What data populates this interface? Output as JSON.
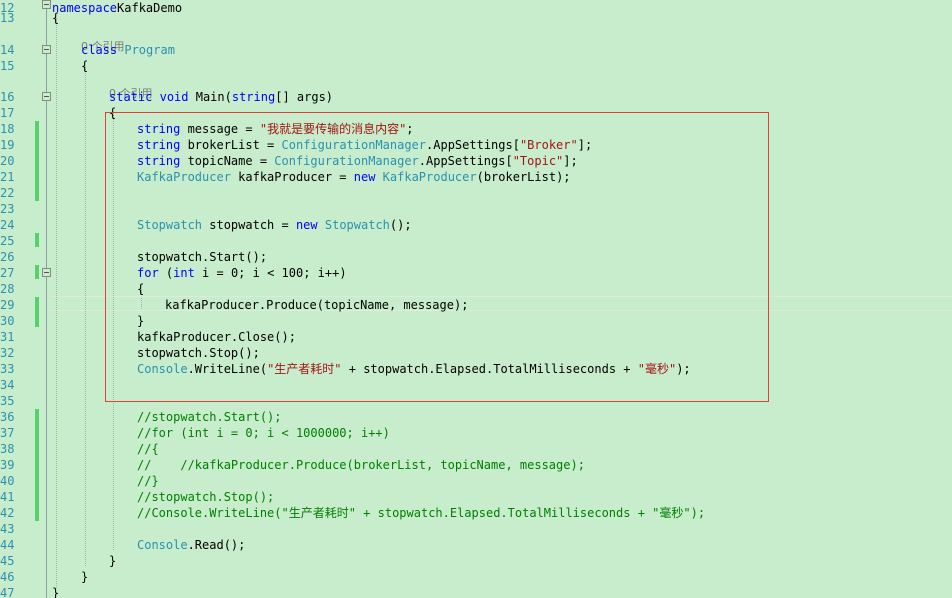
{
  "editor": {
    "ref_hint": "0 个引用",
    "lines": [
      {
        "n": "12",
        "t": 0,
        "i": 52,
        "p": [
          [
            "kw",
            "namespace"
          ],
          [
            "",
            "KafkaDemo"
          ]
        ]
      },
      {
        "n": "13",
        "t": 10,
        "i": 52,
        "p": [
          [
            "",
            "{"
          ]
        ]
      },
      {
        "n": "14",
        "t": 42,
        "i": 81,
        "p": [
          [
            "kw",
            "class"
          ],
          [
            "",
            " "
          ],
          [
            "ty",
            "Program"
          ]
        ]
      },
      {
        "n": "15",
        "t": 58,
        "i": 81,
        "p": [
          [
            "",
            "{"
          ]
        ]
      },
      {
        "n": "16",
        "t": 89,
        "i": 109,
        "p": [
          [
            "kw",
            "static"
          ],
          [
            "",
            " "
          ],
          [
            "kw",
            "void"
          ],
          [
            "",
            " Main("
          ],
          [
            "kw",
            "string"
          ],
          [
            "",
            "[] args)"
          ]
        ]
      },
      {
        "n": "17",
        "t": 105,
        "i": 109,
        "p": [
          [
            "",
            "{"
          ]
        ]
      },
      {
        "n": "18",
        "t": 121,
        "i": 137,
        "p": [
          [
            "kw",
            "string"
          ],
          [
            "",
            " message = "
          ],
          [
            "str",
            "\"我就是要传输的消息内容\""
          ],
          [
            "",
            ";"
          ]
        ]
      },
      {
        "n": "19",
        "t": 137,
        "i": 137,
        "p": [
          [
            "kw",
            "string"
          ],
          [
            "",
            " brokerList = "
          ],
          [
            "ty",
            "ConfigurationManager"
          ],
          [
            "",
            ".AppSettings["
          ],
          [
            "str",
            "\"Broker\""
          ],
          [
            "",
            "];"
          ]
        ]
      },
      {
        "n": "20",
        "t": 153,
        "i": 137,
        "p": [
          [
            "kw",
            "string"
          ],
          [
            "",
            " topicName = "
          ],
          [
            "ty",
            "ConfigurationManager"
          ],
          [
            "",
            ".AppSettings["
          ],
          [
            "str",
            "\"Topic\""
          ],
          [
            "",
            "];"
          ]
        ]
      },
      {
        "n": "21",
        "t": 169,
        "i": 137,
        "p": [
          [
            "ty",
            "KafkaProducer"
          ],
          [
            "",
            " kafkaProducer = "
          ],
          [
            "kw",
            "new"
          ],
          [
            "",
            " "
          ],
          [
            "ty",
            "KafkaProducer"
          ],
          [
            "",
            "(brokerList);"
          ]
        ]
      },
      {
        "n": "22",
        "t": 185,
        "i": 137,
        "p": []
      },
      {
        "n": "23",
        "t": 201,
        "i": 137,
        "p": []
      },
      {
        "n": "24",
        "t": 217,
        "i": 137,
        "p": [
          [
            "ty",
            "Stopwatch"
          ],
          [
            "",
            " stopwatch = "
          ],
          [
            "kw",
            "new"
          ],
          [
            "",
            " "
          ],
          [
            "ty",
            "Stopwatch"
          ],
          [
            "",
            "();"
          ]
        ]
      },
      {
        "n": "25",
        "t": 233,
        "i": 137,
        "p": []
      },
      {
        "n": "26",
        "t": 249,
        "i": 137,
        "p": [
          [
            "",
            "stopwatch.Start();"
          ]
        ]
      },
      {
        "n": "27",
        "t": 265,
        "i": 137,
        "p": [
          [
            "kw",
            "for"
          ],
          [
            "",
            " ("
          ],
          [
            "kw",
            "int"
          ],
          [
            "",
            " i = 0; i < 100; i++)"
          ]
        ]
      },
      {
        "n": "28",
        "t": 281,
        "i": 137,
        "p": [
          [
            "",
            "{"
          ]
        ]
      },
      {
        "n": "29",
        "t": 297,
        "i": 165,
        "p": [
          [
            "",
            "kafkaProducer.Produce(topicName, message);"
          ]
        ]
      },
      {
        "n": "30",
        "t": 313,
        "i": 137,
        "p": [
          [
            "",
            "}"
          ]
        ]
      },
      {
        "n": "31",
        "t": 329,
        "i": 137,
        "p": [
          [
            "",
            "kafkaProducer.Close();"
          ]
        ]
      },
      {
        "n": "32",
        "t": 345,
        "i": 137,
        "p": [
          [
            "",
            "stopwatch.Stop();"
          ]
        ]
      },
      {
        "n": "33",
        "t": 361,
        "i": 137,
        "p": [
          [
            "ty",
            "Console"
          ],
          [
            "",
            ".WriteLine("
          ],
          [
            "str",
            "\"生产者耗时\""
          ],
          [
            "",
            " + stopwatch.Elapsed.TotalMilliseconds + "
          ],
          [
            "str",
            "\"毫秒\""
          ],
          [
            "",
            ");"
          ]
        ]
      },
      {
        "n": "34",
        "t": 377,
        "i": 137,
        "p": []
      },
      {
        "n": "35",
        "t": 393,
        "i": 137,
        "p": []
      },
      {
        "n": "36",
        "t": 409,
        "i": 137,
        "p": [
          [
            "cm",
            "//stopwatch.Start();"
          ]
        ]
      },
      {
        "n": "37",
        "t": 425,
        "i": 137,
        "p": [
          [
            "cm",
            "//for (int i = 0; i < 1000000; i++)"
          ]
        ]
      },
      {
        "n": "38",
        "t": 441,
        "i": 137,
        "p": [
          [
            "cm",
            "//{"
          ]
        ]
      },
      {
        "n": "39",
        "t": 457,
        "i": 137,
        "p": [
          [
            "cm",
            "//    //kafkaProducer.Produce(brokerList, topicName, message);"
          ]
        ]
      },
      {
        "n": "40",
        "t": 473,
        "i": 137,
        "p": [
          [
            "cm",
            "//}"
          ]
        ]
      },
      {
        "n": "41",
        "t": 489,
        "i": 137,
        "p": [
          [
            "cm",
            "//stopwatch.Stop();"
          ]
        ]
      },
      {
        "n": "42",
        "t": 505,
        "i": 137,
        "p": [
          [
            "cm",
            "//Console.WriteLine(\"生产者耗时\" + stopwatch.Elapsed.TotalMilliseconds + \"毫秒\");"
          ]
        ]
      },
      {
        "n": "43",
        "t": 521,
        "i": 137,
        "p": []
      },
      {
        "n": "44",
        "t": 537,
        "i": 137,
        "p": [
          [
            "ty",
            "Console"
          ],
          [
            "",
            ".Read();"
          ]
        ]
      },
      {
        "n": "45",
        "t": 553,
        "i": 109,
        "p": [
          [
            "",
            "}"
          ]
        ]
      },
      {
        "n": "46",
        "t": 569,
        "i": 81,
        "p": [
          [
            "",
            "}"
          ]
        ]
      },
      {
        "n": "47",
        "t": 585,
        "i": 52,
        "p": [
          [
            "",
            "}"
          ]
        ]
      }
    ]
  }
}
